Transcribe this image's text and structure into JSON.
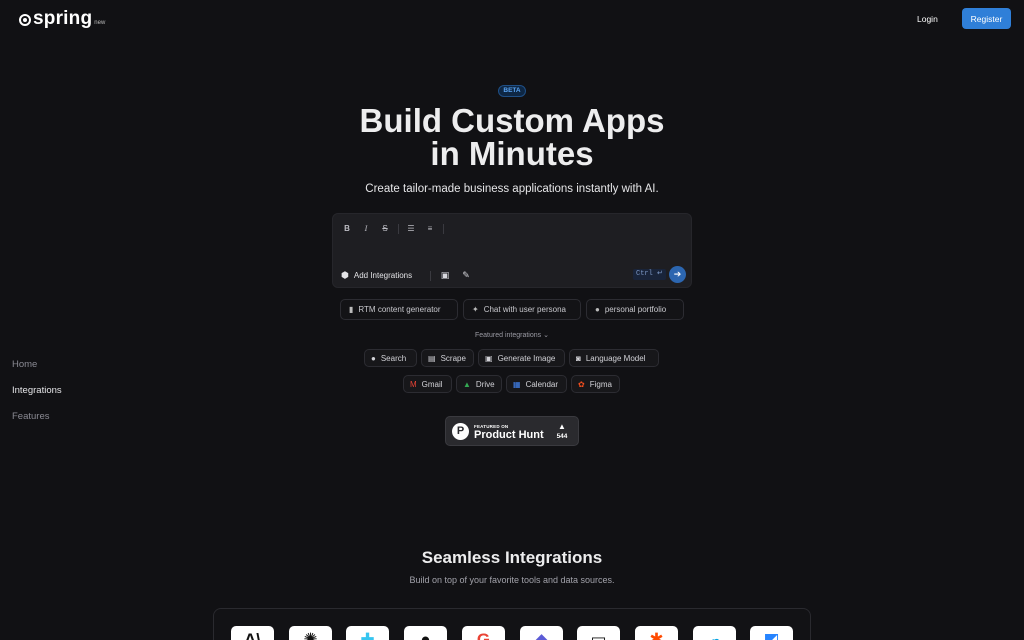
{
  "header": {
    "logo_text": "spring",
    "logo_suffix": "new",
    "login_label": "Login",
    "register_label": "Register",
    "register_color": "#2f7fd8"
  },
  "sidebar": {
    "items": [
      {
        "label": "Home"
      },
      {
        "label": "Integrations"
      },
      {
        "label": "Features"
      }
    ]
  },
  "hero": {
    "badge": "BETA",
    "title_line1": "Build Custom Apps",
    "title_line2": "in Minutes",
    "subtitle": "Create tailor-made business applications instantly with AI."
  },
  "editor": {
    "toolbar_icons": [
      "bold-icon",
      "italic-icon",
      "strikethrough-icon",
      "bullet-list-icon",
      "ordered-list-icon"
    ],
    "add_integrations_label": "Add Integrations",
    "shortcut_hint": "Ctrl ↵"
  },
  "suggestions": [
    {
      "label": "RTM content generator",
      "icon": "bar-chart-icon"
    },
    {
      "label": "Chat with user persona",
      "icon": "sparkle-icon"
    },
    {
      "label": "personal portfolio",
      "icon": "user-circle-icon"
    }
  ],
  "featured_label": "Featured integrations",
  "integrations_row1": [
    {
      "label": "Search",
      "icon": "search-icon"
    },
    {
      "label": "Scrape",
      "icon": "document-icon"
    },
    {
      "label": "Generate Image",
      "icon": "image-icon"
    },
    {
      "label": "Language Model",
      "icon": "robot-icon"
    }
  ],
  "integrations_row2": [
    {
      "label": "Gmail",
      "icon": "gmail-icon"
    },
    {
      "label": "Drive",
      "icon": "drive-icon"
    },
    {
      "label": "Calendar",
      "icon": "calendar-icon"
    },
    {
      "label": "Figma",
      "icon": "figma-icon"
    }
  ],
  "product_hunt": {
    "featured_on": "FEATURED ON",
    "name": "Product Hunt",
    "votes": "544"
  },
  "seamless": {
    "title": "Seamless Integrations",
    "subtitle": "Build on top of your favorite tools and data sources."
  },
  "integration_tiles": [
    {
      "icon": "anthropic-icon"
    },
    {
      "icon": "openai-icon"
    },
    {
      "icon": "slack-icon"
    },
    {
      "icon": "github-icon"
    },
    {
      "icon": "google-icon"
    },
    {
      "icon": "perplexity-icon"
    },
    {
      "icon": "notion-icon"
    },
    {
      "icon": "zapier-icon"
    },
    {
      "icon": "salesforce-icon"
    },
    {
      "icon": "jira-icon"
    }
  ]
}
